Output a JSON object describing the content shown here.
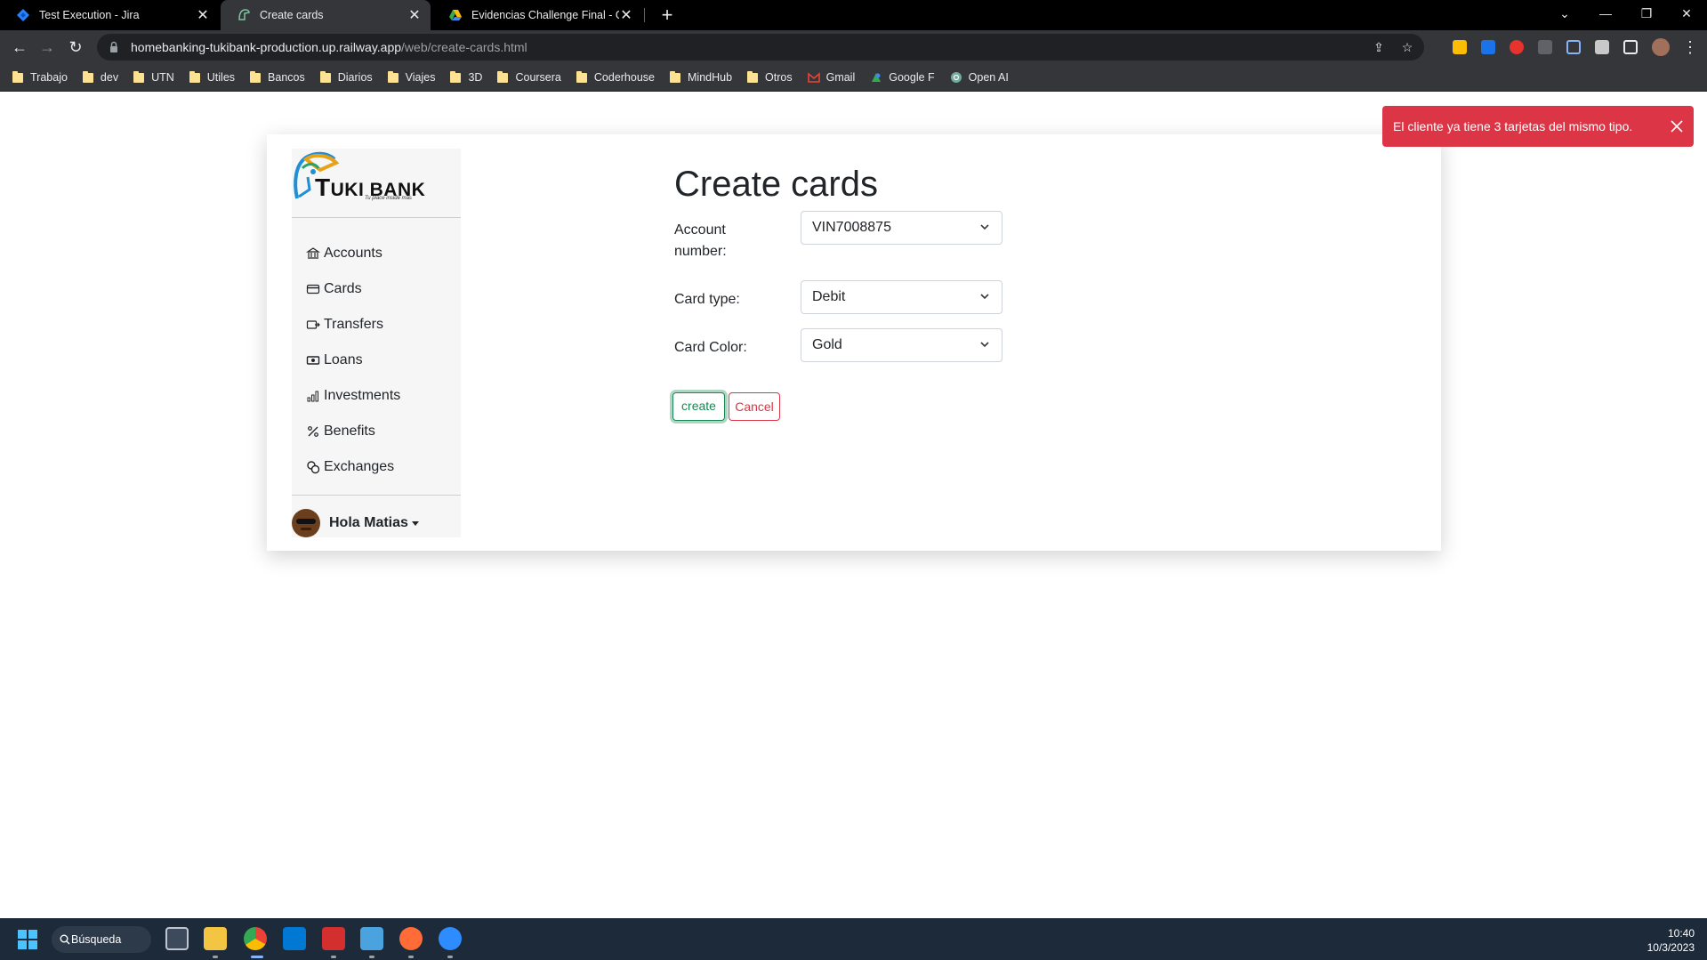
{
  "browser": {
    "tabs": [
      {
        "label": "Test Execution - Jira",
        "icon": "jira-icon",
        "active": false
      },
      {
        "label": "Create cards",
        "icon": "tukibank-favicon-icon",
        "active": true
      },
      {
        "label": "Evidencias Challenge Final - Goo",
        "icon": "google-drive-icon",
        "active": false
      }
    ],
    "url_host": "homebanking-tukibank-production.up.railway.app",
    "url_path": "/web/create-cards.html",
    "bookmarks": [
      "Trabajo",
      "dev",
      "UTN",
      "Utiles",
      "Bancos",
      "Diarios",
      "Viajes",
      "3D",
      "Coursera",
      "Coderhouse",
      "MindHub",
      "Otros",
      "Gmail",
      "Google F",
      "Open AI"
    ],
    "extensions": [
      "bookmark-ext-icon",
      "download-ext-icon",
      "adblock-ext-icon",
      "facebook-ext-icon",
      "link-ext-icon",
      "puzzle-icon",
      "sidepanel-icon",
      "profile-avatar"
    ]
  },
  "app": {
    "logo": {
      "brand_first": "T",
      "brand_rest": "UKI BANK",
      "tagline": "Tu place inside más"
    },
    "nav": [
      {
        "label": "Accounts",
        "icon": "bank-icon"
      },
      {
        "label": "Cards",
        "icon": "credit-card-icon"
      },
      {
        "label": "Transfers",
        "icon": "transfer-icon"
      },
      {
        "label": "Loans",
        "icon": "cash-icon"
      },
      {
        "label": "Investments",
        "icon": "bar-chart-icon"
      },
      {
        "label": "Benefits",
        "icon": "percent-icon"
      },
      {
        "label": "Exchanges",
        "icon": "coins-icon"
      }
    ],
    "user": {
      "greeting": "Hola Matias"
    }
  },
  "form": {
    "title": "Create cards",
    "account_label_line1": "Account",
    "account_label_line2": "number:",
    "account_value": "VIN7008875",
    "card_type_label": "Card type:",
    "card_type_value": "Debit",
    "card_color_label": "Card Color:",
    "card_color_value": "Gold",
    "create_label": "create",
    "cancel_label": "Cancel"
  },
  "toast": {
    "message": "El cliente ya tiene 3 tarjetas del mismo tipo.",
    "color": "#dc3545"
  },
  "taskbar": {
    "search_label": "Búsqueda",
    "time": "10:40",
    "date": "10/3/2023",
    "apps": [
      "task-view-icon",
      "file-explorer-icon",
      "chrome-icon",
      "vscode-icon",
      "acrobat-icon",
      "notepad-icon",
      "postman-icon",
      "zoom-icon"
    ]
  },
  "colors": {
    "success": "#198754",
    "danger": "#dc3545"
  }
}
